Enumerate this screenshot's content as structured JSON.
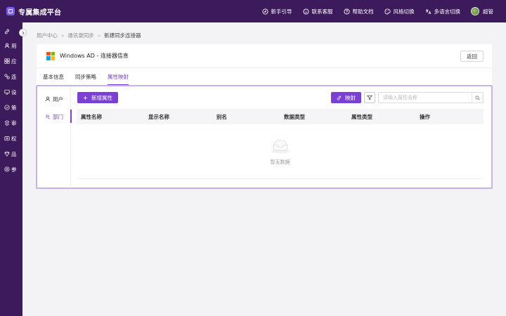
{
  "header": {
    "title": "专属集成平台",
    "actions": [
      {
        "label": "新手引导",
        "icon": "compass-icon"
      },
      {
        "label": "联系客服",
        "icon": "support-icon"
      },
      {
        "label": "帮助文档",
        "icon": "help-icon"
      },
      {
        "label": "风格切换",
        "icon": "palette-icon"
      },
      {
        "label": "多语言切换",
        "icon": "language-icon"
      }
    ],
    "user": {
      "name": "超管"
    }
  },
  "sidebar": {
    "items": [
      {
        "label": "",
        "icon": "link-icon"
      },
      {
        "label": "用",
        "icon": "user-icon"
      },
      {
        "label": "应",
        "icon": "apps-icon"
      },
      {
        "label": "连",
        "icon": "connect-icon"
      },
      {
        "label": "设",
        "icon": "device-icon"
      },
      {
        "label": "策",
        "icon": "policy-icon"
      },
      {
        "label": "审",
        "icon": "audit-icon"
      },
      {
        "label": "权",
        "icon": "permission-icon"
      },
      {
        "label": "品",
        "icon": "brand-icon"
      },
      {
        "label": "参",
        "icon": "settings-icon"
      }
    ]
  },
  "breadcrumb": [
    "用户中心",
    "通讯录同步",
    "新建同步连接器"
  ],
  "card": {
    "title": "Windows AD - 连接器信息",
    "back_label": "返回",
    "ms_colors": [
      "#f25022",
      "#7fba00",
      "#00a4ef",
      "#ffb900"
    ]
  },
  "tabs": [
    {
      "label": "基本信息",
      "active": false
    },
    {
      "label": "同步策略",
      "active": false
    },
    {
      "label": "属性映射",
      "active": true
    }
  ],
  "panel": {
    "nav": [
      {
        "label": "用户",
        "icon": "user-icon",
        "active": false
      },
      {
        "label": "部门",
        "icon": "org-icon",
        "active": true
      }
    ],
    "add_label": "新增属性",
    "map_label": "映射",
    "search_placeholder": "请输入属性名称",
    "columns": [
      "属性名称",
      "显示名称",
      "别名",
      "数据类型",
      "属性类型",
      "操作"
    ],
    "empty_text": "暂无数据"
  },
  "colors": {
    "sidebar_bg": "#3c1a5b",
    "accent": "#7b3fd6",
    "highlight_border": "#c7b1ee"
  }
}
